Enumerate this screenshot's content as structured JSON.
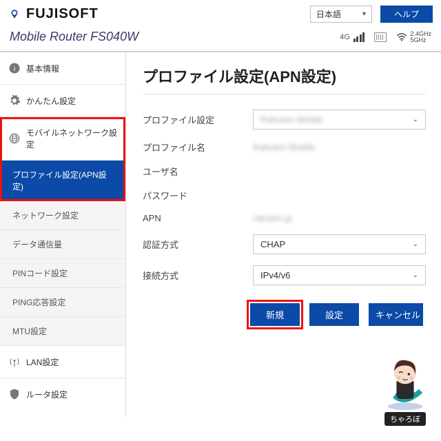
{
  "header": {
    "brand": "FUJISOFT",
    "model": "Mobile Router FS040W",
    "language": "日本語",
    "help": "ヘルプ"
  },
  "status": {
    "signal_gen": "4G",
    "wifi_1": "2.4GHz",
    "wifi_2": "5GHz"
  },
  "sidebar": {
    "items": [
      {
        "name": "basic-info",
        "label": "基本情報",
        "icon": "info-icon"
      },
      {
        "name": "easy-settings",
        "label": "かんたん設定",
        "icon": "gear-icon"
      },
      {
        "name": "mobile-network",
        "label": "モバイルネットワーク設定",
        "icon": "globe-icon"
      },
      {
        "name": "lan-settings",
        "label": "LAN設定",
        "icon": "antenna-icon"
      },
      {
        "name": "router-settings",
        "label": "ルータ設定",
        "icon": "shield-icon"
      }
    ],
    "subitems": [
      {
        "name": "profile-apn",
        "label": "プロファイル設定(APN設定)",
        "active": true
      },
      {
        "name": "network",
        "label": "ネットワーク設定"
      },
      {
        "name": "data-usage",
        "label": "データ通信量"
      },
      {
        "name": "pin-code",
        "label": "PINコード設定"
      },
      {
        "name": "ping",
        "label": "PING応答設定"
      },
      {
        "name": "mtu",
        "label": "MTU設定"
      }
    ]
  },
  "page": {
    "title": "プロファイル設定(APN設定)",
    "fields": {
      "profile_select": "プロファイル設定",
      "profile_name": "プロファイル名",
      "user": "ユーザ名",
      "password": "パスワード",
      "apn": "APN",
      "auth": "認証方式",
      "conn": "接続方式"
    },
    "values": {
      "profile_select": "Rakuten Mobile",
      "profile_name": "Rakuten Mobile",
      "user": "",
      "password": "",
      "apn": "rakuten.jp",
      "auth": "CHAP",
      "conn": "IPv4/v6"
    },
    "buttons": {
      "new": "新規",
      "set": "設定",
      "cancel": "キャンセル"
    }
  },
  "avatar": {
    "name": "ちゃろぼ"
  }
}
